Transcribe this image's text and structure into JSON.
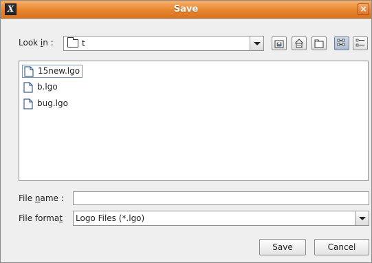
{
  "window": {
    "title": "Save",
    "app_icon_glyph": "X",
    "close_glyph": "×"
  },
  "lookin": {
    "label_pre": "Look ",
    "label_mnemonic": "i",
    "label_post": "n :",
    "value": "t",
    "icon": "folder-icon"
  },
  "toolbar": {
    "buttons": [
      {
        "name": "up-one-level-button",
        "icon": "up-folder-icon"
      },
      {
        "name": "home-button",
        "icon": "home-icon"
      },
      {
        "name": "new-folder-button",
        "icon": "new-folder-icon"
      },
      {
        "name": "list-view-button",
        "icon": "list-view-icon",
        "active": true
      },
      {
        "name": "details-view-button",
        "icon": "details-view-icon"
      }
    ]
  },
  "files": [
    {
      "name": "15new.lgo",
      "selected": true
    },
    {
      "name": "b.lgo",
      "selected": false
    },
    {
      "name": "bug.lgo",
      "selected": false
    }
  ],
  "filename": {
    "label_pre": "File ",
    "label_mnemonic": "n",
    "label_post": "ame :",
    "value": ""
  },
  "fileformat": {
    "label_pre": "File forma",
    "label_mnemonic": "t",
    "label_post": "",
    "value": "Logo Files (*.lgo)"
  },
  "buttons": {
    "save": "Save",
    "cancel": "Cancel"
  },
  "colors": {
    "titlebar": "#e7862f",
    "selection_border": "#7891b5"
  }
}
